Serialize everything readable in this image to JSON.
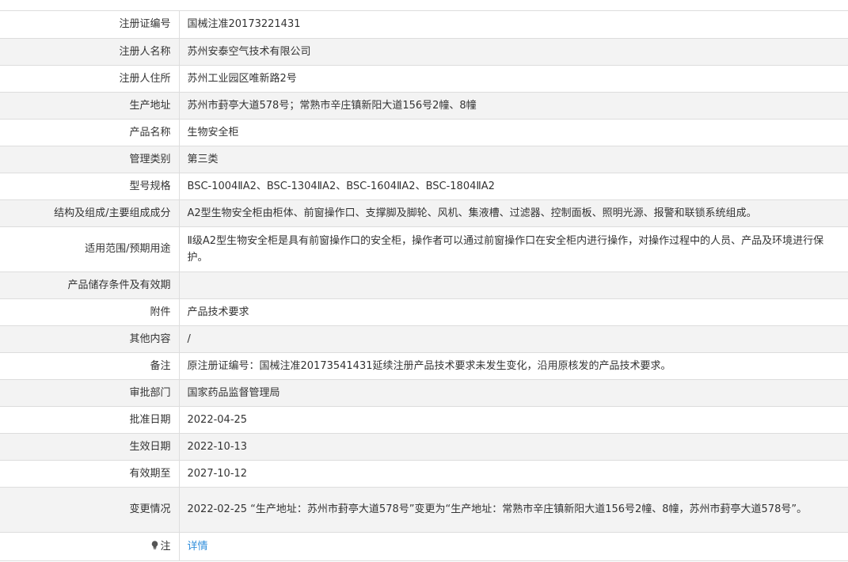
{
  "rows": [
    {
      "label": "注册证编号",
      "value": "国械注准20173221431"
    },
    {
      "label": "注册人名称",
      "value": "苏州安泰空气技术有限公司"
    },
    {
      "label": "注册人住所",
      "value": "苏州工业园区唯新路2号"
    },
    {
      "label": "生产地址",
      "value": "苏州市葑亭大道578号；常熟市辛庄镇新阳大道156号2幢、8幢"
    },
    {
      "label": "产品名称",
      "value": "生物安全柜"
    },
    {
      "label": "管理类别",
      "value": "第三类"
    },
    {
      "label": "型号规格",
      "value": "BSC-1004ⅡA2、BSC-1304ⅡA2、BSC-1604ⅡA2、BSC-1804ⅡA2"
    },
    {
      "label": "结构及组成/主要组成成分",
      "value": "A2型生物安全柜由柜体、前窗操作口、支撑脚及脚轮、风机、集液槽、过滤器、控制面板、照明光源、报警和联锁系统组成。"
    },
    {
      "label": "适用范围/预期用途",
      "value": "Ⅱ级A2型生物安全柜是具有前窗操作口的安全柜，操作者可以通过前窗操作口在安全柜内进行操作，对操作过程中的人员、产品及环境进行保护。"
    },
    {
      "label": "产品储存条件及有效期",
      "value": ""
    },
    {
      "label": "附件",
      "value": "产品技术要求"
    },
    {
      "label": "其他内容",
      "value": "/"
    },
    {
      "label": "备注",
      "value": "原注册证编号：国械注准20173541431延续注册产品技术要求未发生变化，沿用原核发的产品技术要求。"
    },
    {
      "label": "审批部门",
      "value": "国家药品监督管理局"
    },
    {
      "label": "批准日期",
      "value": "2022-04-25"
    },
    {
      "label": "生效日期",
      "value": "2022-10-13"
    },
    {
      "label": "有效期至",
      "value": "2027-10-12"
    },
    {
      "label": "变更情况",
      "value": "2022-02-25 “生产地址：苏州市葑亭大道578号”变更为“生产地址：常熟市辛庄镇新阳大道156号2幢、8幢，苏州市葑亭大道578号”。"
    }
  ],
  "note": {
    "label": "注",
    "link_text": "详情",
    "icon": "lightbulb-icon"
  },
  "colors": {
    "border": "#dddddd",
    "stripe": "#f3f3f3",
    "text": "#333333",
    "link": "#2e8ddb"
  }
}
